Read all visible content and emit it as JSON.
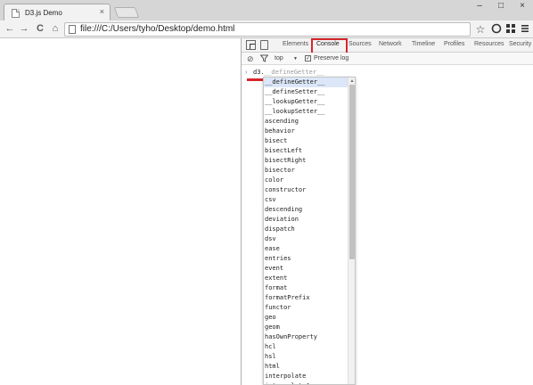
{
  "window": {
    "tab_title": "D3.js Demo",
    "tab_close": "×",
    "controls": [
      "–",
      "□",
      "×"
    ]
  },
  "toolbar": {
    "back": "←",
    "forward": "→",
    "reload": "C",
    "home": "⌂",
    "url": "file:///C:/Users/tyho/Desktop/demo.html",
    "star": "☆"
  },
  "devtools": {
    "tabs": [
      "Elements",
      "Console",
      "Sources",
      "Network",
      "Timeline",
      "Profiles",
      "Resources",
      "Security"
    ],
    "active_tab": "Console",
    "console_bar": {
      "context": "top",
      "context_arrow": "▼",
      "preserve_log_label": "Preserve log",
      "preserve_log_checked": "✓"
    },
    "prompt": {
      "arrow": "›",
      "input": "d3.",
      "ghost": "__defineGetter__"
    },
    "suggestions": [
      "__defineGetter__",
      "__defineSetter__",
      "__lookupGetter__",
      "__lookupSetter__",
      "ascending",
      "behavior",
      "bisect",
      "bisectLeft",
      "bisectRight",
      "bisector",
      "color",
      "constructor",
      "csv",
      "descending",
      "deviation",
      "dispatch",
      "dsv",
      "ease",
      "entries",
      "event",
      "extent",
      "format",
      "formatPrefix",
      "functor",
      "geo",
      "geom",
      "hasOwnProperty",
      "hcl",
      "hsl",
      "html",
      "interpolate",
      "interpolateArray"
    ],
    "selected_index": 0
  },
  "colors": {
    "highlight": "#d7262d",
    "selection": "#dbe7f8"
  }
}
